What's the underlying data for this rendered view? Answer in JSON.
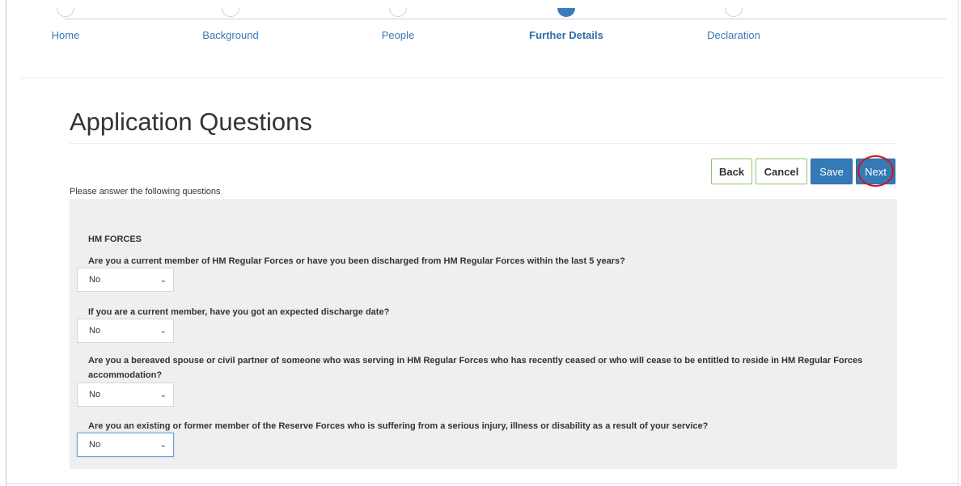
{
  "stepper": {
    "steps": [
      {
        "label": "Home"
      },
      {
        "label": "Background"
      },
      {
        "label": "People"
      },
      {
        "label": "Further Details"
      },
      {
        "label": "Declaration"
      }
    ],
    "active_step": "Further Details"
  },
  "page": {
    "title": "Application Questions",
    "intro": "Please answer the following questions"
  },
  "actions": {
    "back_label": "Back",
    "cancel_label": "Cancel",
    "save_label": "Save",
    "next_label": "Next"
  },
  "form": {
    "section_title": "HM FORCES",
    "questions": [
      {
        "text": "Are you a current member of HM Regular Forces or have you been discharged from HM Regular Forces within the last 5 years?",
        "answer": "No"
      },
      {
        "text": "If you are a current member, have you got an expected discharge date?",
        "answer": "No"
      },
      {
        "text": "Are you a bereaved spouse or civil partner of someone who was serving in HM Regular Forces who has recently ceased or who will cease to be entitled to reside in HM Regular Forces accommodation?",
        "answer": "No"
      },
      {
        "text": "Are you an existing or former member of the Reserve Forces who is suffering from a serious injury, illness or disability as a result of your service?",
        "answer": "No"
      }
    ]
  },
  "colors": {
    "primary": "#337ab7",
    "active_step": "#3a7bbf",
    "highlight_circle": "#d0111b",
    "outline_button_border": "#8fc46a",
    "panel_background": "#efefef"
  }
}
